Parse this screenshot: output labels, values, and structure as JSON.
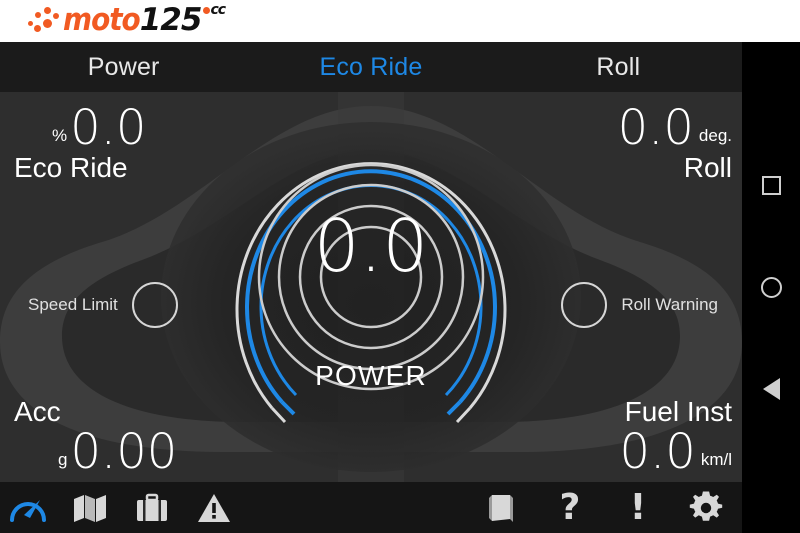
{
  "brand": {
    "name_part1": "moto",
    "name_part2": "125",
    "superscript": "cc",
    "orange": "#f15a22",
    "black": "#111111"
  },
  "theme": {
    "accent_blue": "#1e88e5",
    "screen_background": "#2e2e2e",
    "bar_background": "#1b1b1b",
    "text_white": "#ffffff"
  },
  "tabs": [
    {
      "label": "Power",
      "active": false
    },
    {
      "label": "Eco Ride",
      "active": true
    },
    {
      "label": "Roll",
      "active": false
    }
  ],
  "gauge": {
    "value": "0.0",
    "label": "POWER"
  },
  "readouts": {
    "top_left": {
      "unit": "%",
      "value": "0.0",
      "name": "Eco Ride"
    },
    "top_right": {
      "unit": "deg.",
      "value": "0.0",
      "name": "Roll"
    },
    "bottom_left": {
      "unit": "g",
      "value": "0.00",
      "name": "Acc"
    },
    "bottom_right": {
      "unit": "km/l",
      "value": "0.0",
      "name": "Fuel Inst"
    }
  },
  "indicators": {
    "speed_limit": {
      "label": "Speed Limit",
      "lit": false
    },
    "roll_warning": {
      "label": "Roll Warning",
      "lit": false
    }
  },
  "toolbar": {
    "left": [
      {
        "icon": "speedometer-icon",
        "label": "Dashboard",
        "active": true
      },
      {
        "icon": "map-icon",
        "label": "Map",
        "active": false
      },
      {
        "icon": "briefcase-icon",
        "label": "Trips",
        "active": false
      },
      {
        "icon": "warning-icon",
        "label": "Alerts",
        "active": false
      }
    ],
    "right": [
      {
        "icon": "book-icon",
        "label": "Manual",
        "glyph": ""
      },
      {
        "icon": "question-icon",
        "label": "Help",
        "glyph": "?"
      },
      {
        "icon": "exclamation-icon",
        "label": "Info",
        "glyph": "!"
      },
      {
        "icon": "gear-icon",
        "label": "Settings",
        "glyph": ""
      }
    ]
  },
  "system_nav": [
    {
      "icon": "recents-square-icon",
      "label": "Recents"
    },
    {
      "icon": "home-circle-icon",
      "label": "Home"
    },
    {
      "icon": "back-triangle-icon",
      "label": "Back"
    }
  ]
}
